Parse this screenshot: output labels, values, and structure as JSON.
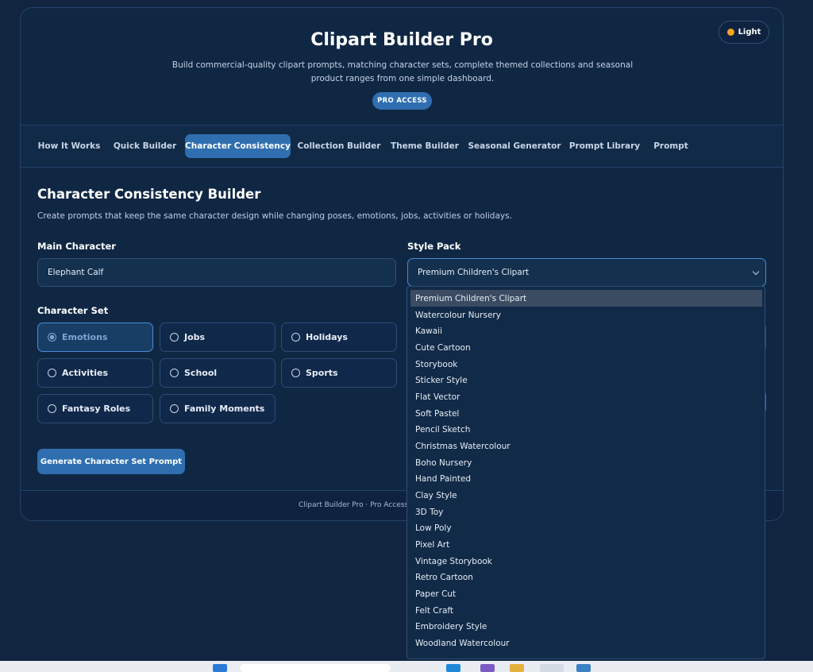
{
  "header": {
    "title": "Clipart Builder Pro",
    "subtitle": "Build commercial-quality clipart prompts, matching character sets, complete themed collections and seasonal product ranges from one simple dashboard.",
    "badge": "PRO ACCESS",
    "theme_toggle": "Light"
  },
  "tabs": [
    {
      "label": "How It Works"
    },
    {
      "label": "Quick Builder"
    },
    {
      "label": "Character Consistency"
    },
    {
      "label": "Collection Builder"
    },
    {
      "label": "Theme Builder"
    },
    {
      "label": "Seasonal Generator"
    },
    {
      "label": "Prompt Library"
    },
    {
      "label": "Prompt"
    }
  ],
  "active_tab": "Character Consistency",
  "section": {
    "title": "Character Consistency Builder",
    "description": "Create prompts that keep the same character design while changing poses, emotions, jobs, activities or holidays."
  },
  "main_character": {
    "label": "Main Character",
    "value": "Elephant Calf"
  },
  "style_pack": {
    "label": "Style Pack",
    "value": "Premium Children's Clipart"
  },
  "character_set": {
    "label": "Character Set",
    "selected": "Emotions",
    "options": [
      "Emotions",
      "Jobs",
      "Holidays",
      "Activities",
      "School",
      "Sports",
      "Fantasy Roles",
      "Family Moments"
    ]
  },
  "generate_button": "Generate Character Set Prompt",
  "footer": "Clipart Builder Pro · Pro Access",
  "dropdown_options": [
    "Premium Children's Clipart",
    "Watercolour Nursery",
    "Kawaii",
    "Cute Cartoon",
    "Storybook",
    "Sticker Style",
    "Flat Vector",
    "Soft Pastel",
    "Pencil Sketch",
    "Christmas Watercolour",
    "Boho Nursery",
    "Hand Painted",
    "Clay Style",
    "3D Toy",
    "Low Poly",
    "Pixel Art",
    "Vintage Storybook",
    "Retro Cartoon",
    "Paper Cut",
    "Felt Craft",
    "Embroidery Style",
    "Woodland Watercolour"
  ],
  "colors": {
    "accent": "#2f6fb0",
    "background": "#112540",
    "card": "#102744"
  }
}
